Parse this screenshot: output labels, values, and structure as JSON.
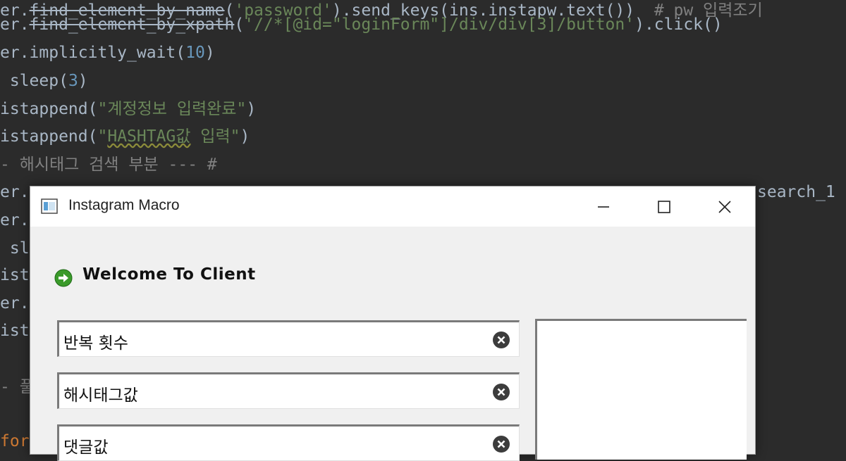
{
  "editor": {
    "lines": [
      {
        "parts": [
          {
            "t": "er.",
            "c": "plain"
          },
          {
            "t": "find_element_by_name",
            "c": "plain strike"
          },
          {
            "t": "(",
            "c": "plain"
          },
          {
            "t": "'password'",
            "c": "str"
          },
          {
            "t": ").send_keys(ins.instapw.text())  ",
            "c": "plain"
          },
          {
            "t": "# pw 입력조기",
            "c": "cmt"
          }
        ]
      },
      {
        "parts": [
          {
            "t": "er.",
            "c": "plain"
          },
          {
            "t": "find_element_by_xpath",
            "c": "plain strike"
          },
          {
            "t": "(",
            "c": "plain"
          },
          {
            "t": "'//*[@id=\"loginForm\"]/div/div[3]/button'",
            "c": "str"
          },
          {
            "t": ").click()",
            "c": "plain"
          }
        ]
      },
      {
        "parts": [
          {
            "t": "er.implicitly_wait(",
            "c": "plain"
          },
          {
            "t": "10",
            "c": "num"
          },
          {
            "t": ")",
            "c": "plain"
          }
        ]
      },
      {
        "parts": [
          {
            "t": " sleep(",
            "c": "plain"
          },
          {
            "t": "3",
            "c": "num"
          },
          {
            "t": ")",
            "c": "plain"
          }
        ]
      },
      {
        "parts": [
          {
            "t": "istappend(",
            "c": "plain"
          },
          {
            "t": "\"계정정보 입력완료\"",
            "c": "str"
          },
          {
            "t": ")",
            "c": "plain"
          }
        ]
      },
      {
        "parts": [
          {
            "t": "istappend(",
            "c": "plain"
          },
          {
            "t": "\"",
            "c": "str"
          },
          {
            "t": "HASHTAG값",
            "c": "str squiggle"
          },
          {
            "t": " 입력\"",
            "c": "str"
          },
          {
            "t": ")",
            "c": "plain"
          }
        ]
      },
      {
        "parts": [
          {
            "t": "- 해시태그 검색 부분 --- #",
            "c": "cmt"
          }
        ]
      },
      {
        "parts": [
          {
            "t": "er.",
            "c": "plain"
          }
        ]
      },
      {
        "parts": [
          {
            "t": "er.i",
            "c": "plain"
          }
        ]
      },
      {
        "parts": [
          {
            "t": " sle",
            "c": "plain"
          }
        ]
      },
      {
        "parts": [
          {
            "t": "ist",
            "c": "plain"
          }
        ]
      },
      {
        "parts": [
          {
            "t": "er.",
            "c": "plain"
          }
        ]
      },
      {
        "parts": [
          {
            "t": "ist",
            "c": "plain"
          }
        ]
      },
      {
        "parts": [
          {
            "t": "",
            "c": "plain"
          }
        ]
      },
      {
        "parts": [
          {
            "t": "- 풀",
            "c": "cmt"
          }
        ]
      },
      {
        "parts": [
          {
            "t": "",
            "c": "plain"
          }
        ]
      },
      {
        "parts": [
          {
            "t": "for",
            "c": "kw"
          }
        ]
      }
    ],
    "right_fragment": "search_1"
  },
  "window": {
    "title": "Instagram Macro",
    "minimize_label": "—",
    "maximize_label": "☐",
    "close_label": "✕",
    "welcome": "Welcome To Client",
    "fields": [
      {
        "value": "반복 횟수"
      },
      {
        "value": "해시태그값"
      },
      {
        "value": "댓글값"
      }
    ]
  },
  "colors": {
    "editor_bg": "#2b2b2b",
    "string": "#6a8759",
    "number": "#6897bb",
    "comment": "#808080",
    "welcome_icon": "#3a9a2a"
  },
  "icons": {
    "app": "window-app-icon",
    "welcome": "green-arrow-circle-icon",
    "clear": "clear-x-circle-icon"
  }
}
